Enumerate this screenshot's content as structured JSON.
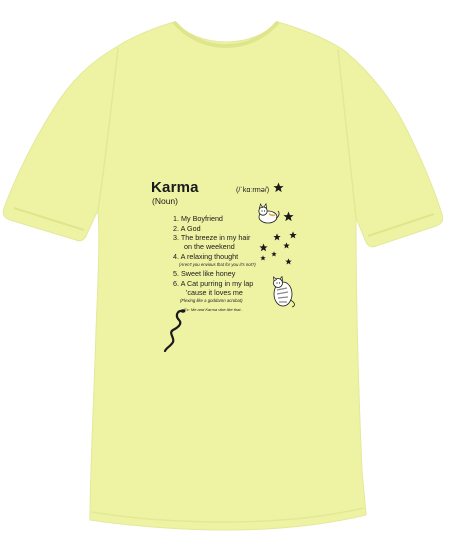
{
  "shirt": {
    "color": "#eef3a4",
    "shade_color": "#dfe58c"
  },
  "print": {
    "title": "Karma",
    "pronunciation": "(/ˈkɑːrmə/)",
    "part_of_speech": "(Noun)",
    "items": [
      "1. My Boyfriend",
      "2. A God",
      "3. The breeze in my hair",
      "on the weekend",
      "4. A relaxing thought",
      "(Aren't you envious that  for you it's not?)",
      "5. Sweet like honey",
      "6.  A Cat purring in my lap",
      "'cause it loves me",
      "(Flexing like a goddamn acrobat)",
      "Ex: Me and Karma vibe like that.."
    ],
    "ink_color": "#1a1a1a"
  },
  "icons": {
    "stars": "star-icon",
    "cat_top": "cat-icon",
    "cat_bottom": "cat-lying-icon",
    "snake": "snake-icon"
  }
}
